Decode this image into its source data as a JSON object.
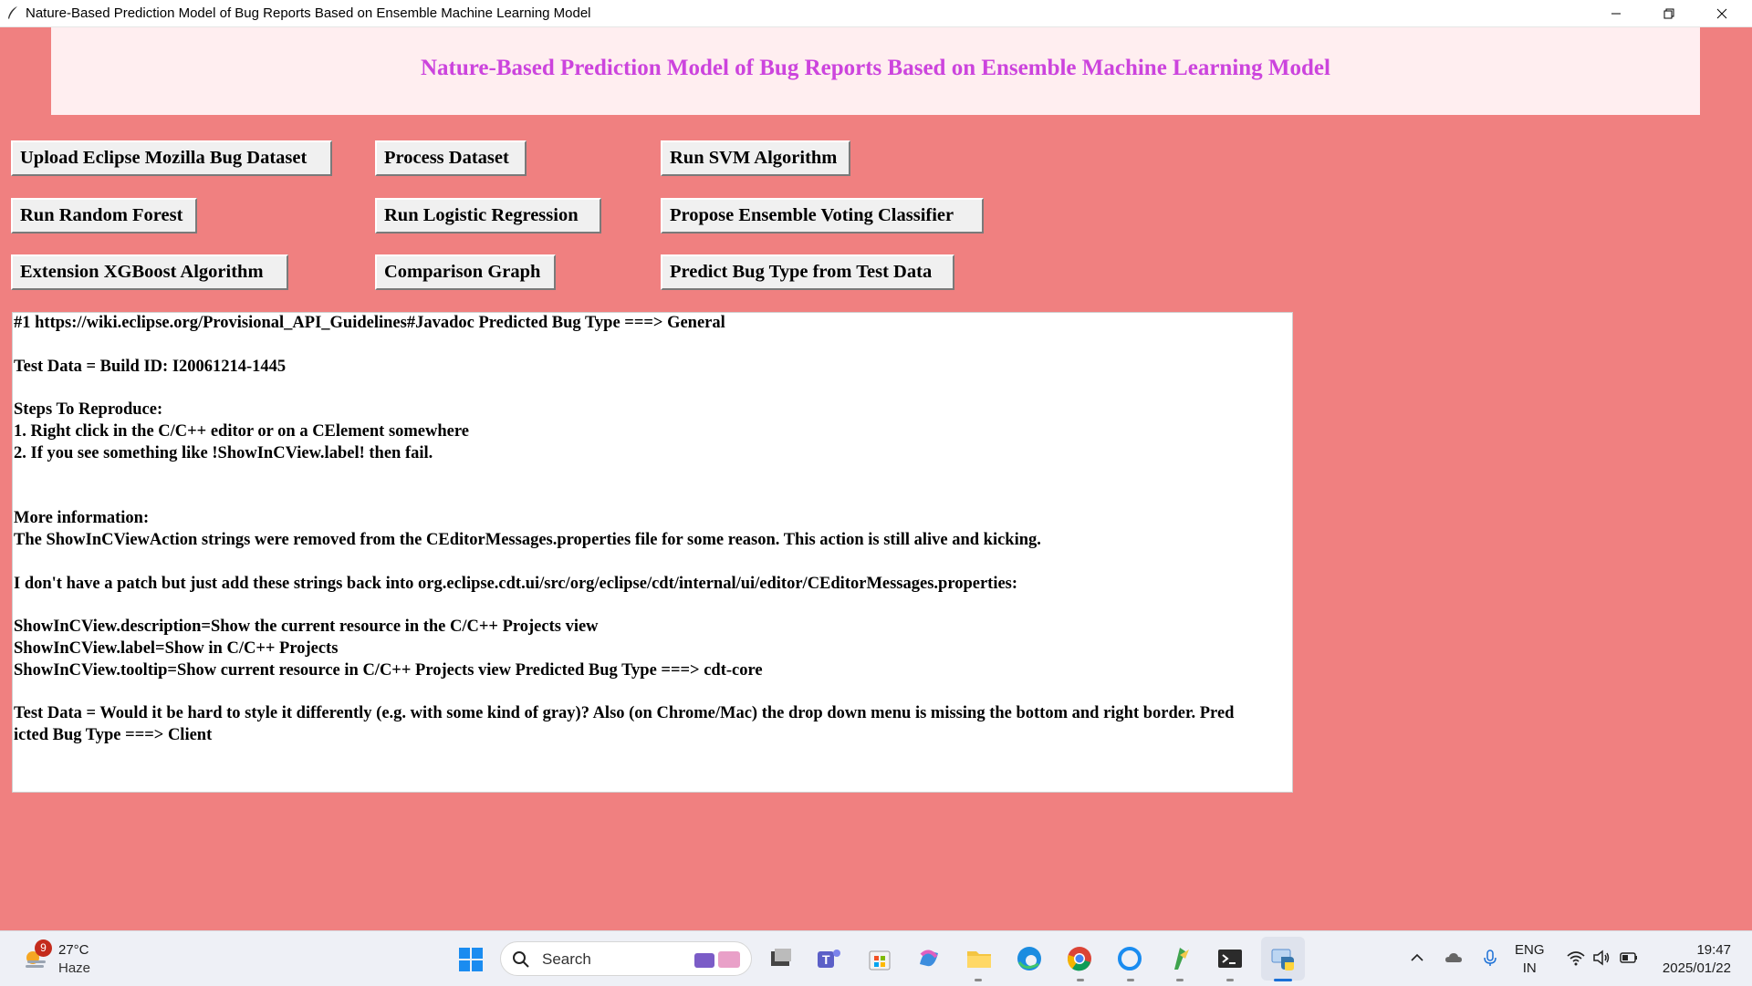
{
  "window": {
    "title": "Nature-Based Prediction Model of Bug Reports Based on Ensemble Machine Learning Model"
  },
  "header": {
    "heading": "Nature-Based Prediction Model of Bug Reports Based on Ensemble Machine Learning Model",
    "color": "#cc44dd",
    "background": "#ffeef0"
  },
  "colors": {
    "window_background": "#f08080",
    "button_face": "#f0f0f0"
  },
  "buttons": {
    "upload": "Upload Eclipse Mozilla Bug Dataset",
    "process": "Process Dataset",
    "svm": "Run SVM Algorithm",
    "random_forest": "Run Random Forest",
    "logistic": "Run Logistic Regression",
    "ensemble": "Propose Ensemble Voting Classifier",
    "xgboost": "Extension XGBoost Algorithm",
    "graph": "Comparison Graph",
    "predict": "Predict Bug Type from Test Data"
  },
  "output": {
    "lines": [
      "#1 https://wiki.eclipse.org/Provisional_API_Guidelines#Javadoc Predicted Bug Type ===> General",
      "",
      "Test Data = Build ID: I20061214-1445",
      "",
      "Steps To Reproduce:",
      "1. Right click in the C/C++ editor or on a CElement somewhere",
      "2. If you see something like !ShowInCView.label! then fail.",
      "",
      "",
      "More information:",
      "The ShowInCViewAction strings were removed from the CEditorMessages.properties file for some reason.  This action is still alive and kicking.",
      "",
      "I don't have a patch but just add these strings back into org.eclipse.cdt.ui/src/org/eclipse/cdt/internal/ui/editor/CEditorMessages.properties:",
      "",
      "ShowInCView.description=Show the current resource in the C/C++ Projects view",
      "ShowInCView.label=Show in C/C++ Projects",
      "ShowInCView.tooltip=Show current resource in C/C++ Projects view Predicted Bug Type ===> cdt-core",
      "",
      "Test Data = Would it be hard to style it differently (e.g. with some kind of gray)? Also (on Chrome/Mac) the drop down menu is missing the bottom and right border. Pred",
      "icted Bug Type ===> Client"
    ]
  },
  "taskbar": {
    "weather": {
      "badge": "9",
      "temperature": "27°C",
      "condition": "Haze"
    },
    "search": {
      "label": "Search"
    },
    "apps": [
      "widgets-icon",
      "task-view-icon",
      "teams-icon",
      "store-icon",
      "copilot-icon",
      "file-explorer-icon",
      "edge-icon",
      "chrome-icon",
      "cortana-icon",
      "python-idle-icon",
      "terminal-icon",
      "python-app-icon"
    ],
    "tray": {
      "language": "ENG",
      "region": "IN",
      "time": "19:47",
      "date": "2025/01/22"
    }
  }
}
